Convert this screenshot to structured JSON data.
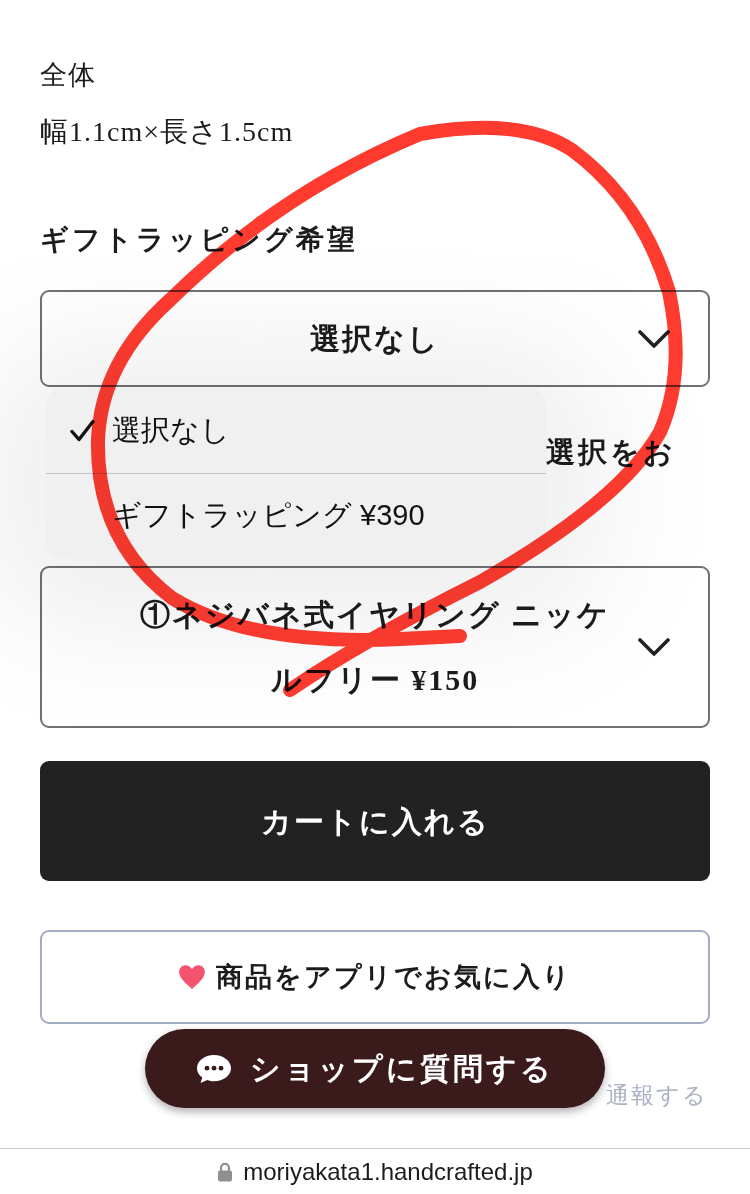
{
  "size_spec": {
    "label": "全体",
    "value": "幅1.1cm×長さ1.5cm"
  },
  "gift_wrapping": {
    "label": "ギフトラッピング希望",
    "select": {
      "value": "選択なし",
      "expanded": true
    },
    "options": [
      {
        "label": "選択なし",
        "selected": true
      },
      {
        "label": "ギフトラッピング ¥390",
        "selected": false
      }
    ]
  },
  "earring_option": {
    "label": "選択をお",
    "select": {
      "value": "①ネジバネ式イヤリング ニッケルフリー ¥150"
    }
  },
  "add_to_cart_button": "カートに入れる",
  "favorite_button": "商品をアプリでお気に入り",
  "ask_shop_button": "ショップに質問する",
  "report_link": "通報する",
  "address_bar": {
    "url": "moriyakata1.handcrafted.jp",
    "secure": true
  },
  "annotation": {
    "kind": "freehand_loop"
  }
}
